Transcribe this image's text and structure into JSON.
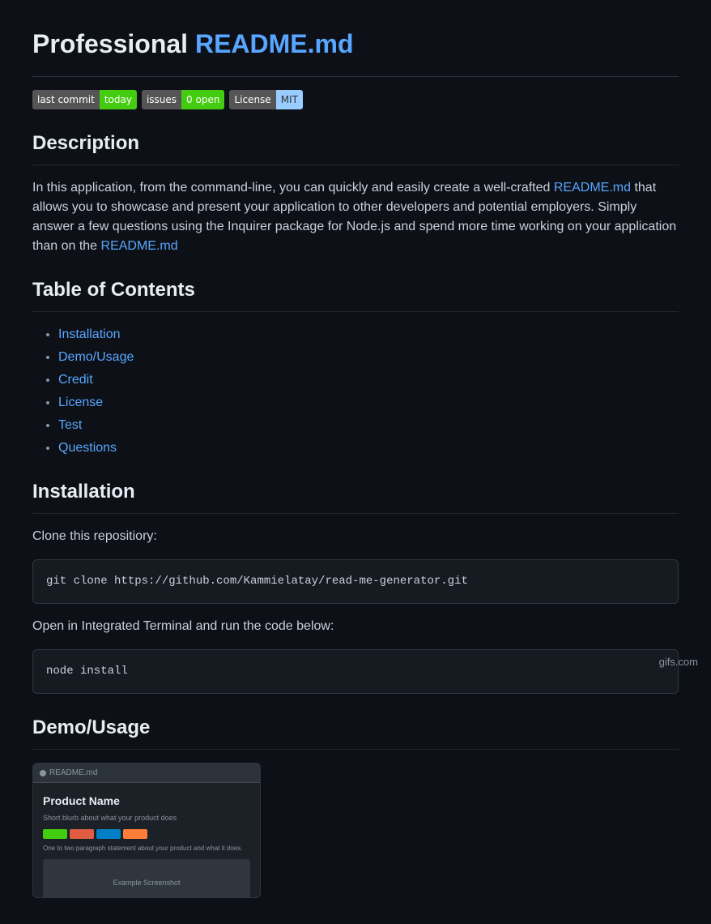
{
  "header": {
    "title_prefix": "Professional ",
    "title_link": "README.md",
    "title_link_url": "#"
  },
  "badges": [
    {
      "left": "last commit",
      "right": "today",
      "right_color": "green"
    },
    {
      "left": "issues",
      "right": "0 open",
      "right_color": "green"
    },
    {
      "left": "License",
      "right": "MIT",
      "right_color": "blue"
    }
  ],
  "description": {
    "heading": "Description",
    "paragraph1_before": "In this application, from the command-line, you can quickly and easily create a well-crafted ",
    "paragraph1_link": "README.md",
    "paragraph1_link_url": "#",
    "paragraph1_after": " that allows you to showcase and present your application to other developers and potential employers. Simply answer a few questions using the Inquirer package for Node.js and spend more time working on your application than on the ",
    "paragraph1_link2": "README.md",
    "paragraph1_link2_url": "#"
  },
  "toc": {
    "heading": "Table of Contents",
    "items": [
      {
        "label": "Installation",
        "href": "#installation"
      },
      {
        "label": "Demo/Usage",
        "href": "#demousage"
      },
      {
        "label": "Credit",
        "href": "#credit"
      },
      {
        "label": "License",
        "href": "#license"
      },
      {
        "label": "Test",
        "href": "#test"
      },
      {
        "label": "Questions",
        "href": "#questions"
      }
    ]
  },
  "installation": {
    "heading": "Installation",
    "step1": "Clone this repositiory:",
    "code1": "git clone https://github.com/Kammielatay/read-me-generator.git",
    "step2": "Open in Integrated Terminal and run the code below:",
    "code2": "node install"
  },
  "demo": {
    "heading": "Demo/Usage",
    "image_top_bar_text": "README.md",
    "product_name": "Product Name",
    "subtitle": "Short blurb about what your product does",
    "paragraph": "One to two paragraph statement about your product and what it does.",
    "screenshot_label": "Example Screenshot"
  },
  "watermark": "gifs.com"
}
